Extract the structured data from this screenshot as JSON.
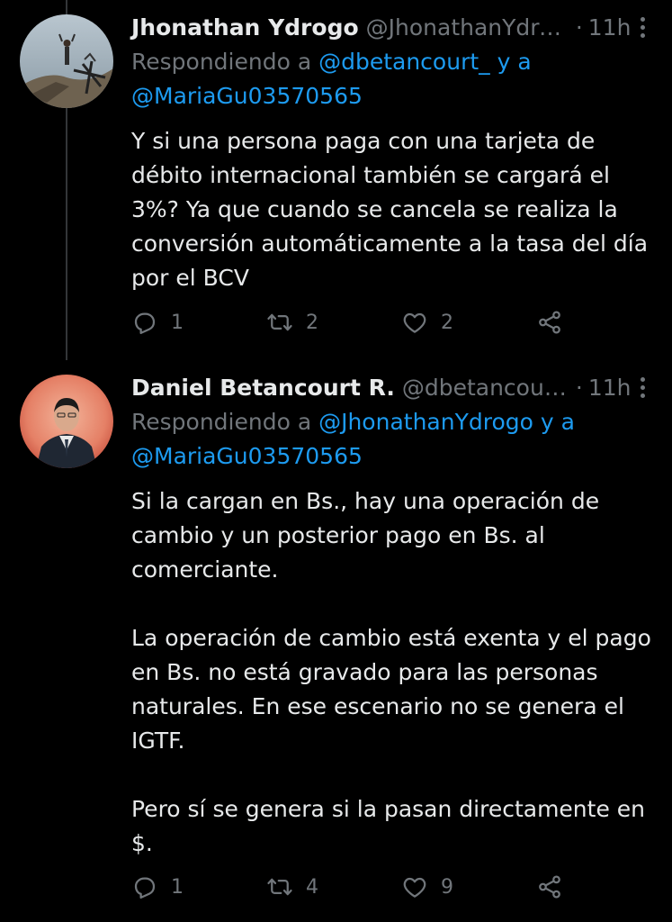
{
  "tweets": [
    {
      "name": "Jhonathan Ydrogo",
      "handle": "@JhonathanYdro...",
      "dot": "·",
      "time": "11h",
      "replying_prefix": "Respondiendo a ",
      "replying_to_1": "@dbetancourt_",
      "replying_and": " y a",
      "replying_to_2": "@MariaGu03570565",
      "text": "Y si una persona paga con una tarjeta de débito internacional también se cargará el 3%? Ya que cuando se cancela se realiza la conversión automáticamente a la tasa del día por el BCV",
      "replies": "1",
      "retweets": "2",
      "likes": "2"
    },
    {
      "name": "Daniel Betancourt R.",
      "handle": "@dbetancourt_",
      "dot": "·",
      "time": "11h",
      "replying_prefix": "Respondiendo a ",
      "replying_to_1": "@JhonathanYdrogo",
      "replying_and": " y a",
      "replying_to_2": "@MariaGu03570565",
      "text": "Si la cargan en Bs., hay una operación de cambio y un posterior pago en Bs. al comerciante.\n\nLa operación de cambio está exenta y el pago en Bs. no está gravado para las personas naturales. En ese escenario no se genera el IGTF.\n\nPero sí se genera si la pasan directamente en $.",
      "replies": "1",
      "retweets": "4",
      "likes": "9"
    }
  ],
  "colors": {
    "background": "#000000",
    "text": "#e7e9ea",
    "muted": "#71767b",
    "link": "#1d9bf0"
  },
  "icons": [
    "reply-icon",
    "retweet-icon",
    "like-icon",
    "share-icon",
    "more-icon"
  ]
}
